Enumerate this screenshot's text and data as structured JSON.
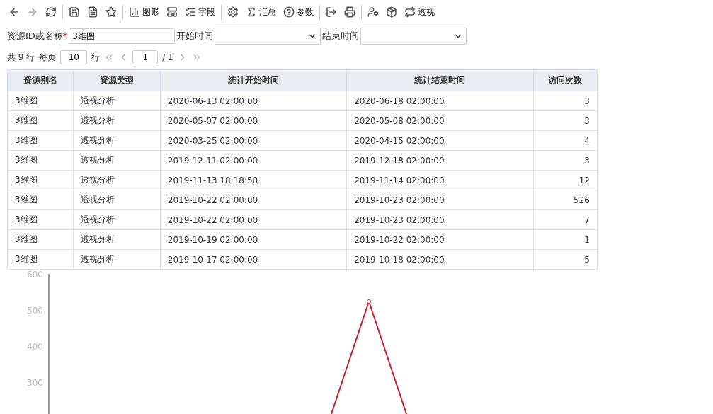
{
  "toolbar": {
    "groups": [
      [
        {
          "disabled": false
        },
        {
          "disabled": true
        },
        {
          "disabled": false
        }
      ],
      [
        {
          "disabled": false
        },
        {
          "disabled": false
        },
        {
          "disabled": false
        }
      ],
      [
        {
          "label": "图形",
          "disabled": false
        },
        {
          "disabled": false
        },
        {
          "label": "字段",
          "disabled": false
        }
      ],
      [
        {
          "disabled": false
        },
        {
          "label": "汇总",
          "disabled": false
        },
        {
          "label": "参数",
          "disabled": false
        }
      ],
      [
        {
          "disabled": false
        },
        {
          "disabled": false
        }
      ],
      [
        {
          "disabled": false
        },
        {
          "disabled": false
        },
        {
          "label": "透视",
          "disabled": false
        }
      ]
    ]
  },
  "filters": {
    "name_label": "资源ID或名称",
    "required_mark": "*",
    "name_value": "3维图",
    "start_label": "开始时间",
    "end_label": "结束时间"
  },
  "pager": {
    "total": "共 9 行",
    "per_page_label": "每页",
    "per_page": "10",
    "rows_unit": "行",
    "page": "1",
    "pages": "/ 1"
  },
  "table": {
    "columns": [
      "资源别名",
      "资源类型",
      "统计开始时间",
      "统计结束时间",
      "访问次数"
    ],
    "rows": [
      [
        "3维图",
        "透视分析",
        "2020-06-13  02:00:00",
        "2020-06-18  02:00:00",
        "3"
      ],
      [
        "3维图",
        "透视分析",
        "2020-05-07  02:00:00",
        "2020-05-08  02:00:00",
        "3"
      ],
      [
        "3维图",
        "透视分析",
        "2020-03-25  02:00:00",
        "2020-04-15  02:00:00",
        "4"
      ],
      [
        "3维图",
        "透视分析",
        "2019-12-11  02:00:00",
        "2019-12-18  02:00:00",
        "3"
      ],
      [
        "3维图",
        "透视分析",
        "2019-11-13  18:18:50",
        "2019-11-14  02:00:00",
        "12"
      ],
      [
        "3维图",
        "透视分析",
        "2019-10-22  02:00:00",
        "2019-10-23  02:00:00",
        "526"
      ],
      [
        "3维图",
        "透视分析",
        "2019-10-22  02:00:00",
        "2019-10-23  02:00:00",
        "7"
      ],
      [
        "3维图",
        "透视分析",
        "2019-10-19  02:00:00",
        "2019-10-22  02:00:00",
        "1"
      ],
      [
        "3维图",
        "透视分析",
        "2019-10-17  02:00:00",
        "2019-10-18  02:00:00",
        "5"
      ]
    ]
  },
  "chart": {
    "y_axis_labels": [
      "600",
      "500",
      "400",
      "300"
    ]
  }
}
